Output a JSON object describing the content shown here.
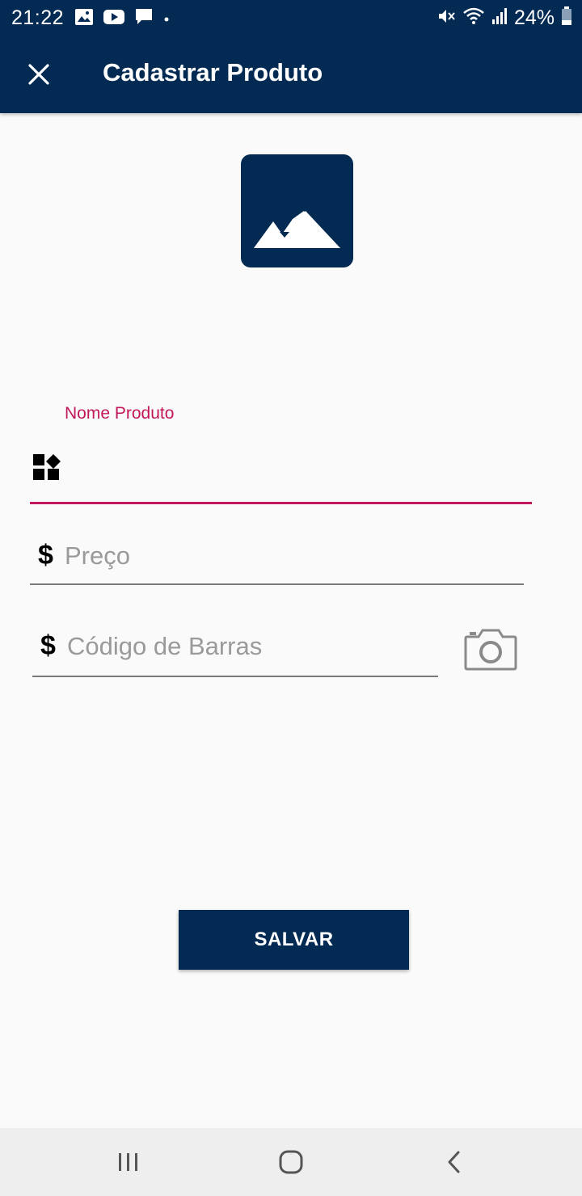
{
  "status_bar": {
    "time": "21:22",
    "battery": "24%",
    "icons_left": [
      "image-icon",
      "youtube-icon",
      "message-icon",
      "dot-icon"
    ],
    "icons_right": [
      "mute-icon",
      "wifi-icon",
      "signal-icon",
      "battery-icon"
    ]
  },
  "app_bar": {
    "title": "Cadastrar Produto",
    "close_icon": "close-icon"
  },
  "product_image": {
    "icon": "image-placeholder-icon"
  },
  "form": {
    "nome": {
      "label": "Nome Produto",
      "value": "",
      "icon": "widgets-icon"
    },
    "preco": {
      "placeholder": "Preço",
      "icon": "dollar-icon",
      "symbol": "$"
    },
    "codigo": {
      "placeholder": "Código de Barras",
      "icon": "dollar-icon",
      "symbol": "$"
    },
    "camera_icon": "camera-icon"
  },
  "save_button": {
    "label": "SALVAR"
  },
  "nav_bar": {
    "items": [
      "recents-icon",
      "home-icon",
      "back-icon"
    ]
  },
  "colors": {
    "primary": "#022a52",
    "accent": "#c2185b",
    "background": "#fafafa"
  }
}
